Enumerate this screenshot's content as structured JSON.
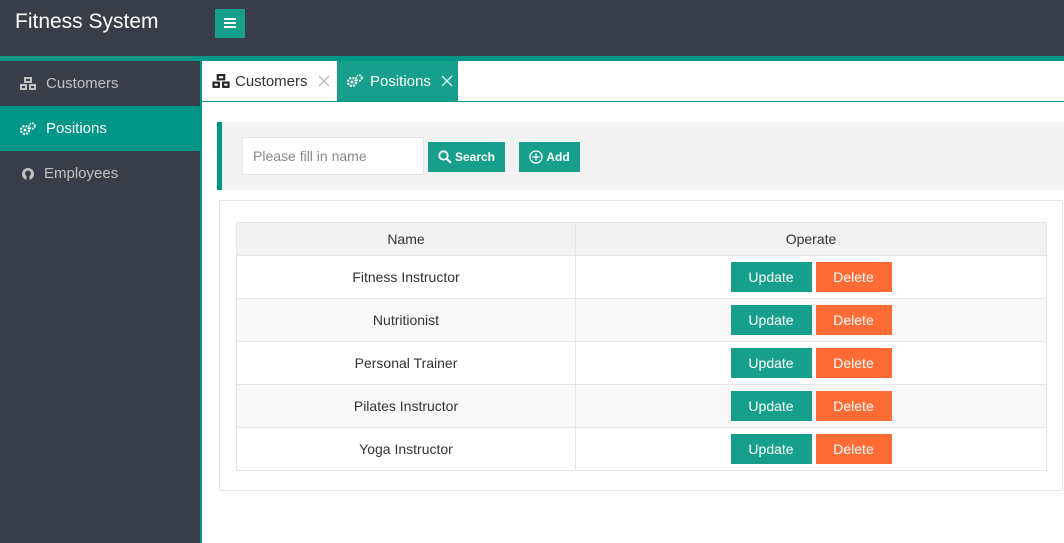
{
  "app": {
    "title": "Fitness System"
  },
  "sidebar": {
    "items": [
      {
        "label": "Customers",
        "icon": "cubes-icon",
        "active": false
      },
      {
        "label": "Positions",
        "icon": "cogs-icon",
        "active": true
      },
      {
        "label": "Employees",
        "icon": "github-icon",
        "active": false
      }
    ]
  },
  "tabs": [
    {
      "label": "Customers",
      "icon": "cubes-icon",
      "active": false
    },
    {
      "label": "Positions",
      "icon": "cogs-icon",
      "active": true
    }
  ],
  "search": {
    "placeholder": "Please fill in name",
    "value": "",
    "search_label": "Search",
    "add_label": "Add"
  },
  "table": {
    "columns": [
      "Name",
      "Operate"
    ],
    "rows": [
      {
        "name": "Fitness Instructor"
      },
      {
        "name": "Nutritionist"
      },
      {
        "name": "Personal Trainer"
      },
      {
        "name": "Pilates Instructor"
      },
      {
        "name": "Yoga Instructor"
      }
    ],
    "update_label": "Update",
    "delete_label": "Delete"
  },
  "colors": {
    "header_bg": "#393d49",
    "accent": "#009688",
    "button_teal": "#16a08c",
    "delete_orange": "#ff6b35"
  }
}
